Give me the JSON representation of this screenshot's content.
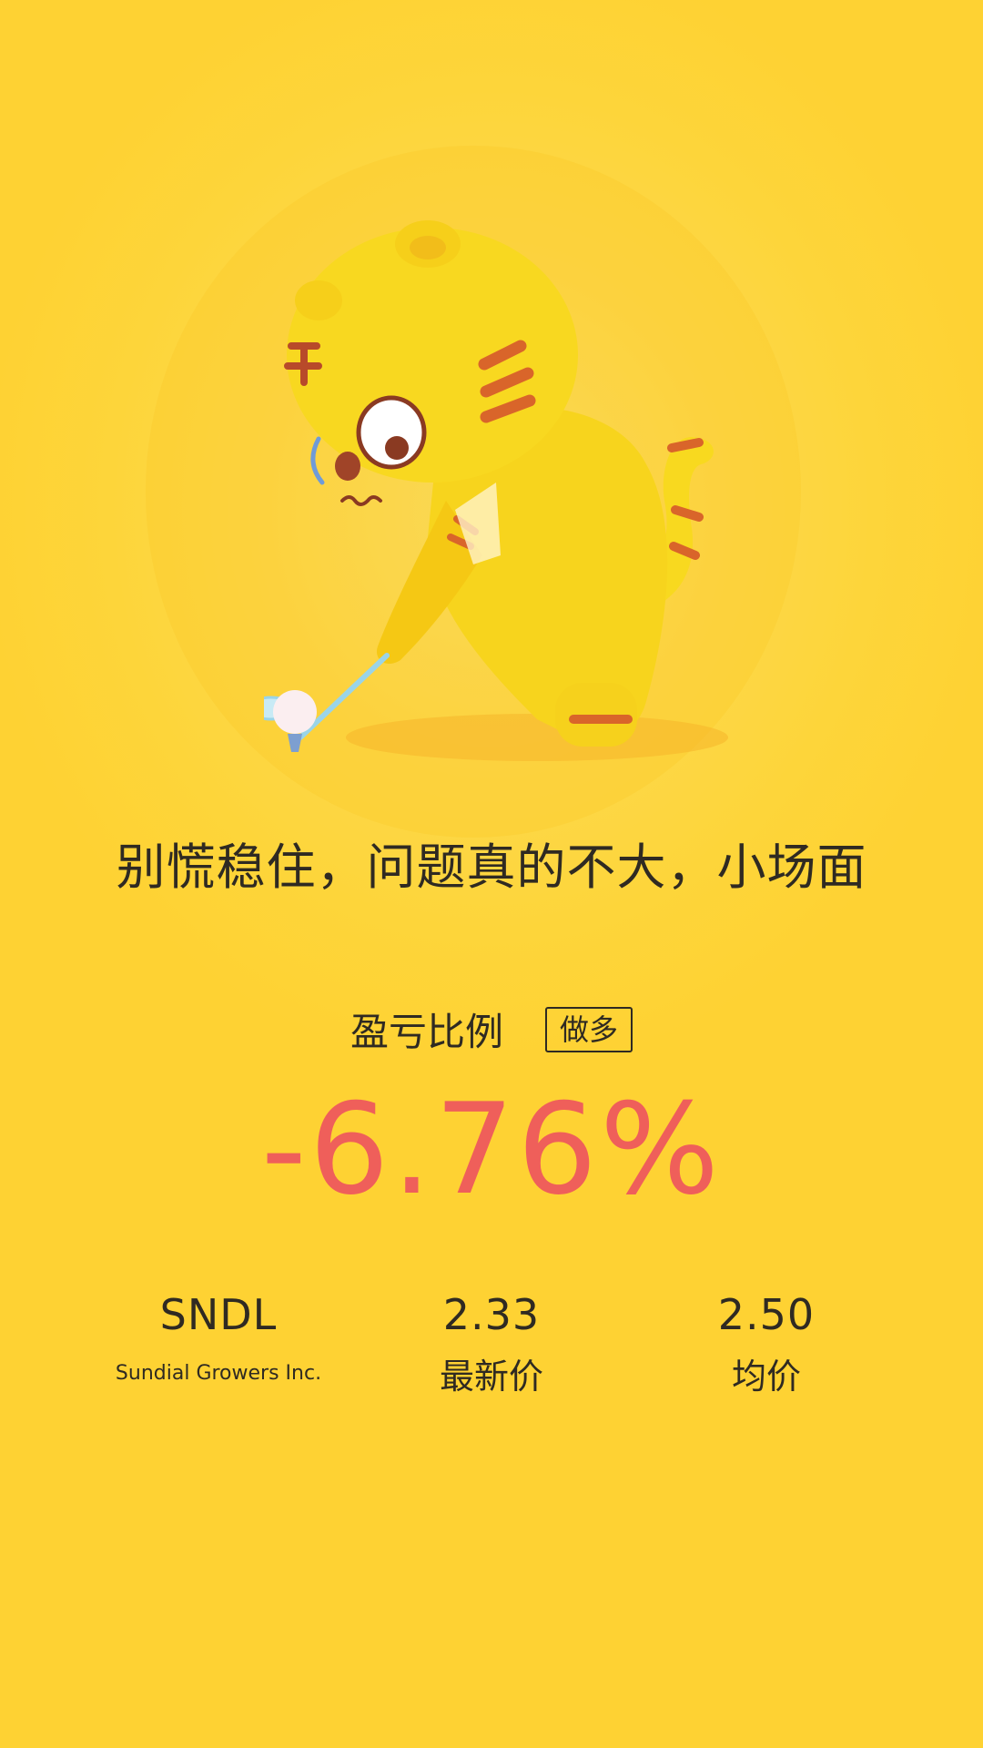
{
  "headline": "别慌稳住，问题真的不大，小场面",
  "ratio": {
    "label": "盈亏比例",
    "position_type": "做多",
    "value": "-6.76%"
  },
  "stock": {
    "ticker": "SNDL",
    "company": "Sundial Growers Inc.",
    "latest_price": "2.33",
    "latest_price_label": "最新价",
    "avg_price": "2.50",
    "avg_price_label": "均价"
  },
  "colors": {
    "background": "#fdd53a",
    "loss": "#ef5f5a",
    "text": "#2f2a22"
  }
}
